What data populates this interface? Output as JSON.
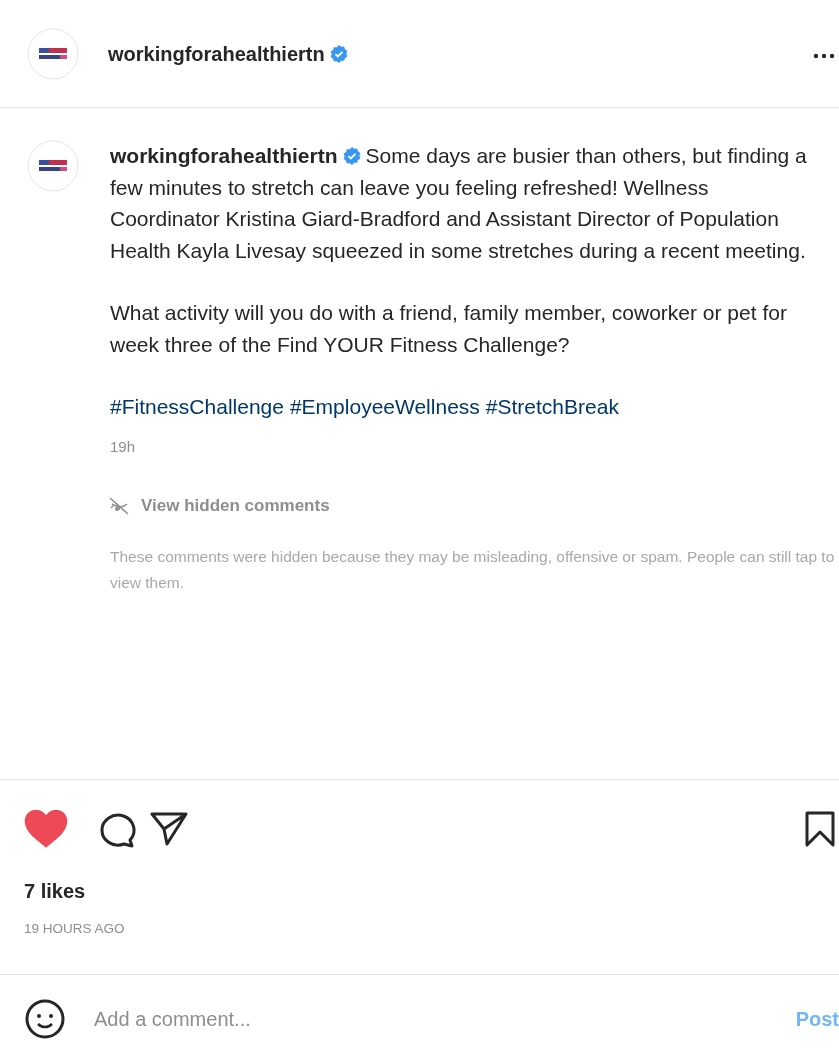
{
  "header": {
    "username": "workingforahealthiertn",
    "verified": true
  },
  "caption": {
    "username": "workingforahealthiertn",
    "verified": true,
    "paragraphs": [
      "Some days are busier than others, but finding a few minutes to stretch can leave you feeling refreshed! Wellness Coordinator Kristina Giard-Bradford and Assistant Director of Population Health Kayla Livesay squeezed in some stretches during a recent meeting.",
      "What activity will you do with a friend, family member, coworker or pet for week three of the Find YOUR Fitness Challenge?"
    ],
    "hashtags": [
      "#FitnessChallenge",
      "#EmployeeWellness",
      "#StretchBreak"
    ],
    "time": "19h"
  },
  "hidden_comments": {
    "link": "View hidden comments",
    "notice": "These comments were hidden because they may be misleading, offensive or spam. People can still tap to view them."
  },
  "actions": {
    "liked": true
  },
  "likes": "7 likes",
  "posted": "19 HOURS AGO",
  "comment_box": {
    "placeholder": "Add a comment...",
    "post_button": "Post",
    "disabled": true
  }
}
